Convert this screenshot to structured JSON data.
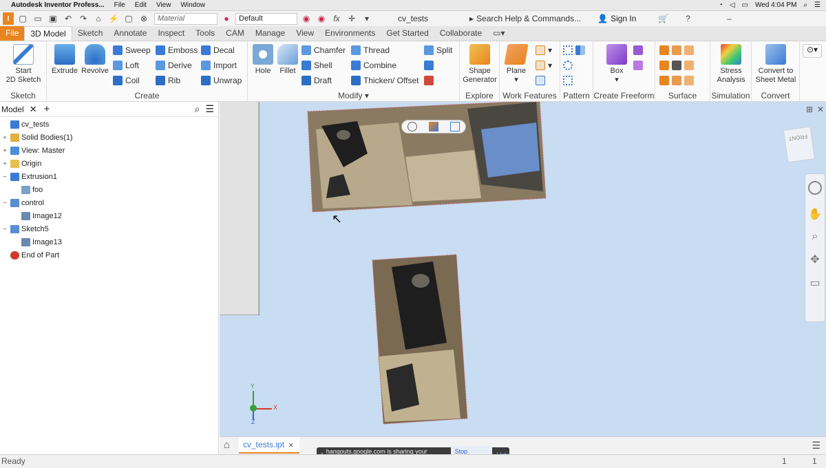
{
  "macbar": {
    "app": "Autodesk Inventor Profess...",
    "menus": [
      "File",
      "Edit",
      "View",
      "Window"
    ],
    "clock": "Wed 4:04 PM"
  },
  "qab": {
    "material_placeholder": "Material",
    "appearance": "Default",
    "fx": "fx",
    "doc_title": "cv_tests",
    "search": "Search Help & Commands...",
    "signin": "Sign In"
  },
  "tabs": [
    "File",
    "3D Model",
    "Sketch",
    "Annotate",
    "Inspect",
    "Tools",
    "CAM",
    "Manage",
    "View",
    "Environments",
    "Get Started",
    "Collaborate"
  ],
  "ribbon": {
    "sketch": {
      "title": "Sketch",
      "start": "Start",
      "start2": "2D Sketch"
    },
    "create": {
      "title": "Create",
      "extrude": "Extrude",
      "revolve": "Revolve",
      "sweep": "Sweep",
      "loft": "Loft",
      "coil": "Coil",
      "emboss": "Emboss",
      "derive": "Derive",
      "rib": "Rib",
      "decal": "Decal",
      "import": "Import",
      "unwrap": "Unwrap"
    },
    "modify": {
      "title": "Modify",
      "hole": "Hole",
      "fillet": "Fillet",
      "chamfer": "Chamfer",
      "shell": "Shell",
      "draft": "Draft",
      "thread": "Thread",
      "combine": "Combine",
      "thicken": "Thicken/ Offset",
      "split": "Split"
    },
    "explore": {
      "title": "Explore",
      "shape": "Shape",
      "generator": "Generator"
    },
    "work": {
      "title": "Work Features",
      "plane": "Plane"
    },
    "pattern": {
      "title": "Pattern"
    },
    "freeform": {
      "title": "Create Freeform",
      "box": "Box"
    },
    "surface": {
      "title": "Surface"
    },
    "simulation": {
      "title": "Simulation",
      "stress": "Stress",
      "analysis": "Analysis"
    },
    "convert": {
      "title": "Convert",
      "convert": "Convert to",
      "sheet": "Sheet Metal"
    }
  },
  "browser": {
    "header": "Model",
    "items": [
      {
        "label": "cv_tests",
        "expander": "",
        "color": "#3a7bd5"
      },
      {
        "label": "Solid Bodies(1)",
        "expander": "+",
        "color": "#e0b040"
      },
      {
        "label": "View: Master",
        "expander": "+",
        "color": "#4a8fd8"
      },
      {
        "label": "Origin",
        "expander": "+",
        "color": "#e8c050"
      },
      {
        "label": "Extrusion1",
        "expander": "−",
        "color": "#3a7bd5"
      },
      {
        "label": "foo",
        "expander": "",
        "color": "#7aa0c8"
      },
      {
        "label": "control",
        "expander": "−",
        "color": "#5a8fcf"
      },
      {
        "label": "Image12",
        "expander": "",
        "color": "#6a8ab0"
      },
      {
        "label": "Sketch5",
        "expander": "−",
        "color": "#5a8fcf"
      },
      {
        "label": "Image13",
        "expander": "",
        "color": "#6a8ab0"
      },
      {
        "label": "End of Part",
        "expander": "",
        "color": "#d03a2a"
      }
    ]
  },
  "viewport": {
    "triad_y": "Y",
    "triad_x": "X",
    "triad_z": "Z",
    "viewcube": "FRONT"
  },
  "doctab": {
    "label": "cv_tests.ipt",
    "close": "×"
  },
  "sharing": {
    "text": "hangouts.google.com is sharing your screen.",
    "stop": "Stop sharing",
    "hide": "Hide"
  },
  "status": {
    "left": "Ready",
    "n1": "1",
    "n2": "1"
  }
}
